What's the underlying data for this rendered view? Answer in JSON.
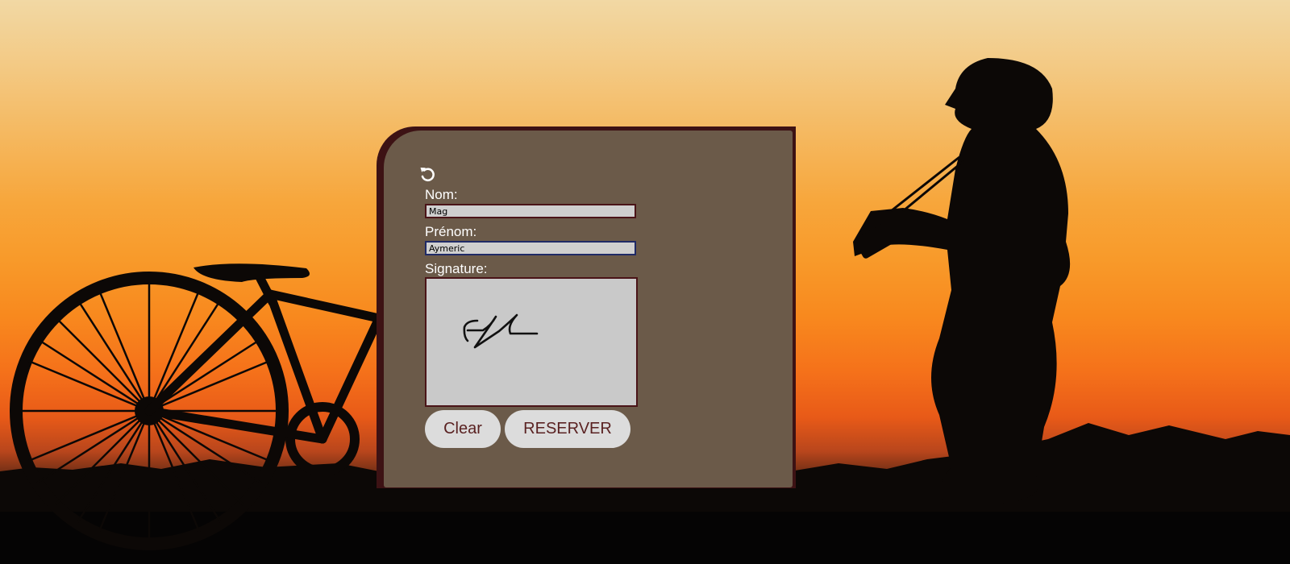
{
  "form": {
    "nom_label": "Nom:",
    "nom_value": "Mag",
    "prenom_label": "Prénom:",
    "prenom_value": "Aymeric",
    "signature_label": "Signature:",
    "clear_label": "Clear",
    "reserve_label": "RESERVER"
  },
  "icons": {
    "undo": "undo-icon"
  },
  "colors": {
    "card": "#6b5a49",
    "card_border": "#3d1214",
    "input_bg": "#cfcfcf",
    "button_bg": "#dcdcdc",
    "button_text": "#5a2222"
  }
}
